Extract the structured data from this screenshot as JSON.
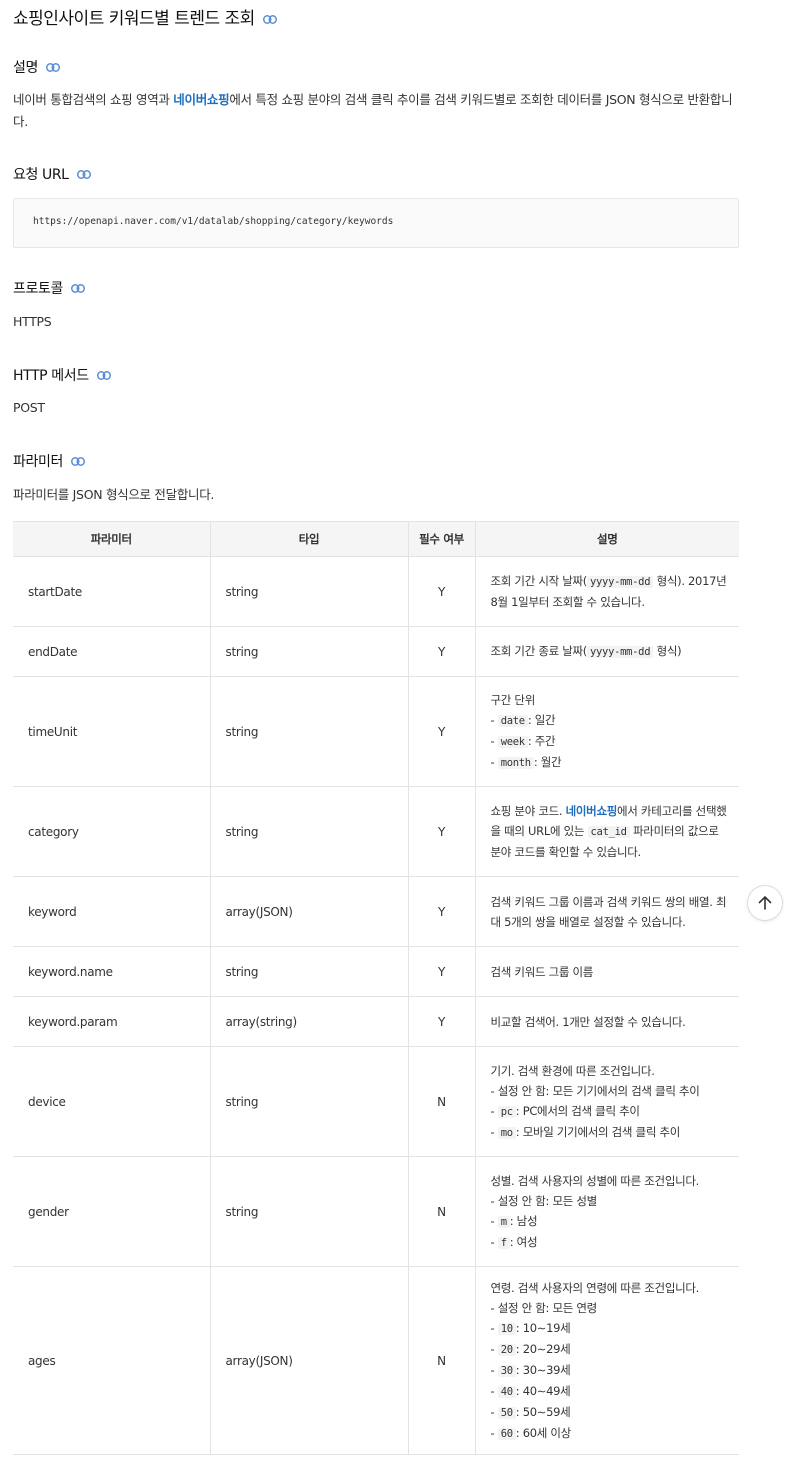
{
  "title": "쇼핑인사이트 키워드별 트렌드 조회",
  "sections": {
    "description": {
      "heading": "설명",
      "text_before": "네이버 통합검색의 쇼핑 영역과 ",
      "link": "네이버쇼핑",
      "text_after": "에서 특정 쇼핑 분야의 검색 클릭 추이를 검색 키워드별로 조회한 데이터를 JSON 형식으로 반환합니다."
    },
    "request_url": {
      "heading": "요청 URL",
      "url": "https://openapi.naver.com/v1/datalab/shopping/category/keywords"
    },
    "protocol": {
      "heading": "프로토콜",
      "value": "HTTPS"
    },
    "http_method": {
      "heading": "HTTP 메서드",
      "value": "POST"
    },
    "parameters": {
      "heading": "파라미터",
      "intro": "파라미터를 JSON 형식으로 전달합니다."
    }
  },
  "table": {
    "headers": [
      "파라미터",
      "타입",
      "필수 여부",
      "설명"
    ],
    "rows": [
      {
        "name": "startDate",
        "type": "string",
        "required": "Y",
        "desc": [
          [
            {
              "t": "조회 기간 시작 날짜("
            },
            {
              "c": "yyyy-mm-dd"
            },
            {
              "t": " 형식). 2017년 8월 1일부터 조회할 수 있습니다."
            }
          ]
        ]
      },
      {
        "name": "endDate",
        "type": "string",
        "required": "Y",
        "desc": [
          [
            {
              "t": "조회 기간 종료 날짜("
            },
            {
              "c": "yyyy-mm-dd"
            },
            {
              "t": " 형식)"
            }
          ]
        ]
      },
      {
        "name": "timeUnit",
        "type": "string",
        "required": "Y",
        "desc": [
          [
            {
              "t": "구간 단위"
            }
          ],
          [
            {
              "t": "- "
            },
            {
              "c": "date"
            },
            {
              "t": ": 일간"
            }
          ],
          [
            {
              "t": "- "
            },
            {
              "c": "week"
            },
            {
              "t": ": 주간"
            }
          ],
          [
            {
              "t": "- "
            },
            {
              "c": "month"
            },
            {
              "t": ": 월간"
            }
          ]
        ]
      },
      {
        "name": "category",
        "type": "string",
        "required": "Y",
        "desc": [
          [
            {
              "t": "쇼핑 분야 코드. "
            },
            {
              "a": "네이버쇼핑"
            },
            {
              "t": "에서 카테고리를 선택했을 때의 URL에 있는 "
            },
            {
              "c": "cat_id"
            },
            {
              "t": " 파라미터의 값으로 분야 코드를 확인할 수 있습니다."
            }
          ]
        ]
      },
      {
        "name": "keyword",
        "type": "array(JSON)",
        "required": "Y",
        "desc": [
          [
            {
              "t": "검색 키워드 그룹 이름과 검색 키워드 쌍의 배열. 최대 5개의 쌍을 배열로 설정할 수 있습니다."
            }
          ]
        ]
      },
      {
        "name": "keyword.name",
        "type": "string",
        "required": "Y",
        "desc": [
          [
            {
              "t": "검색 키워드 그룹 이름"
            }
          ]
        ]
      },
      {
        "name": "keyword.param",
        "type": "array(string)",
        "required": "Y",
        "desc": [
          [
            {
              "t": "비교할 검색어. 1개만 설정할 수 있습니다."
            }
          ]
        ]
      },
      {
        "name": "device",
        "type": "string",
        "required": "N",
        "desc": [
          [
            {
              "t": "기기. 검색 환경에 따른 조건입니다."
            }
          ],
          [
            {
              "t": "- 설정 안 함: 모든 기기에서의 검색 클릭 추이"
            }
          ],
          [
            {
              "t": "- "
            },
            {
              "c": "pc"
            },
            {
              "t": ": PC에서의 검색 클릭 추이"
            }
          ],
          [
            {
              "t": "- "
            },
            {
              "c": "mo"
            },
            {
              "t": ": 모바일 기기에서의 검색 클릭 추이"
            }
          ]
        ]
      },
      {
        "name": "gender",
        "type": "string",
        "required": "N",
        "desc": [
          [
            {
              "t": "성별. 검색 사용자의 성별에 따른 조건입니다."
            }
          ],
          [
            {
              "t": "- 설정 안 함: 모든 성별"
            }
          ],
          [
            {
              "t": "- "
            },
            {
              "c": "m"
            },
            {
              "t": ": 남성"
            }
          ],
          [
            {
              "t": "- "
            },
            {
              "c": "f"
            },
            {
              "t": ": 여성"
            }
          ]
        ]
      },
      {
        "name": "ages",
        "type": "array(JSON)",
        "required": "N",
        "desc": [
          [
            {
              "t": "연령. 검색 사용자의 연령에 따른 조건입니다."
            }
          ],
          [
            {
              "t": "- 설정 안 함: 모든 연령"
            }
          ],
          [
            {
              "t": "- "
            },
            {
              "c": "10"
            },
            {
              "t": ": 10∼19세"
            }
          ],
          [
            {
              "t": "- "
            },
            {
              "c": "20"
            },
            {
              "t": ": 20∼29세"
            }
          ],
          [
            {
              "t": "- "
            },
            {
              "c": "30"
            },
            {
              "t": ": 30∼39세"
            }
          ],
          [
            {
              "t": "- "
            },
            {
              "c": "40"
            },
            {
              "t": ": 40∼49세"
            }
          ],
          [
            {
              "t": "- "
            },
            {
              "c": "50"
            },
            {
              "t": ": 50∼59세"
            }
          ],
          [
            {
              "t": "- "
            },
            {
              "c": "60"
            },
            {
              "t": ": 60세 이상"
            }
          ]
        ]
      }
    ]
  },
  "colors": {
    "accent": "#1f6ebf",
    "link_icon": "#5c8fd6"
  },
  "icons": {
    "section_link": "link-icon",
    "scroll_top": "arrow-up-icon"
  }
}
